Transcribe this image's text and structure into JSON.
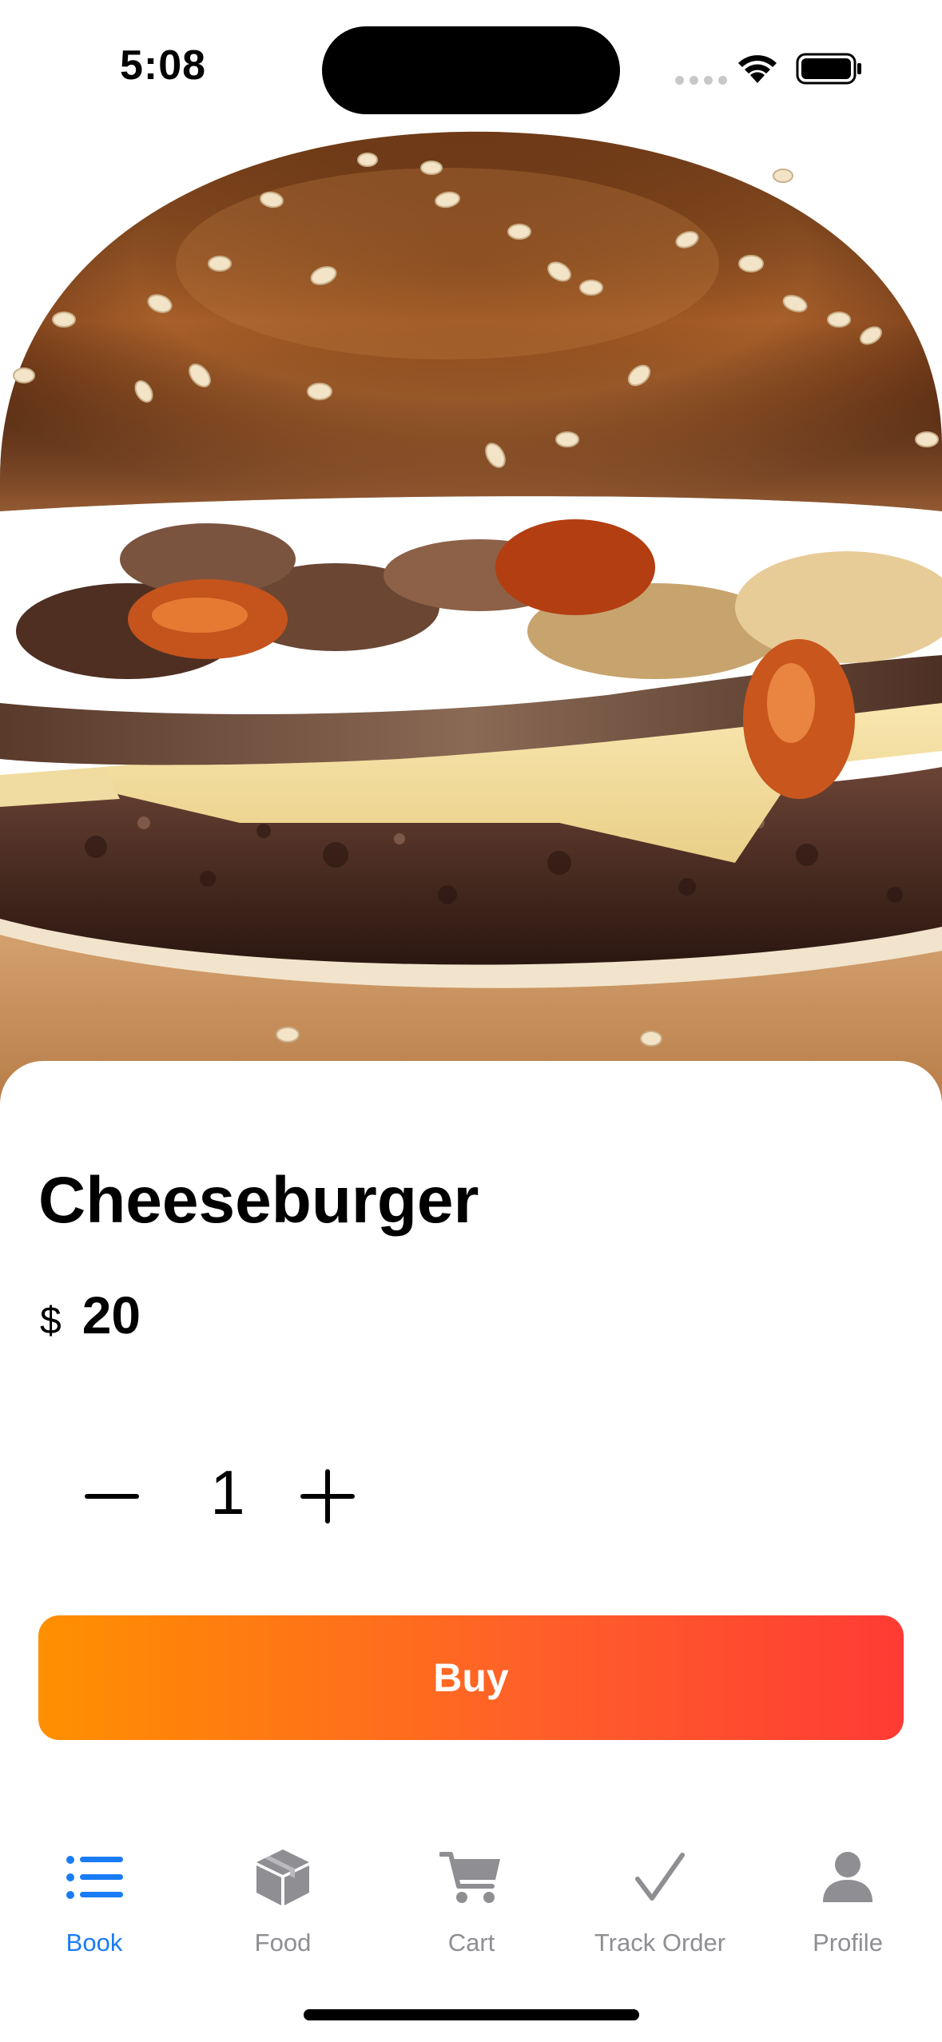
{
  "status_bar": {
    "time": "5:08"
  },
  "hero": {
    "image": "cheeseburger-photo"
  },
  "product": {
    "name": "Cheeseburger",
    "currency": "$",
    "price": "20",
    "quantity": "1"
  },
  "actions": {
    "buy_label": "Buy",
    "buy_gradient_start": "#ff9000",
    "buy_gradient_end": "#ff3b34"
  },
  "tabbar": {
    "active_color": "#1a7cf5",
    "inactive_color": "#8e8e93",
    "items": [
      {
        "label": "Book",
        "icon": "list-icon",
        "active": true
      },
      {
        "label": "Food",
        "icon": "box-icon",
        "active": false
      },
      {
        "label": "Cart",
        "icon": "cart-icon",
        "active": false
      },
      {
        "label": "Track Order",
        "icon": "checkmark-icon",
        "active": false
      },
      {
        "label": "Profile",
        "icon": "person-icon",
        "active": false
      }
    ]
  }
}
